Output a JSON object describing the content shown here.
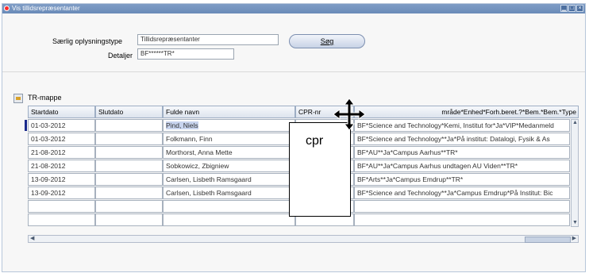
{
  "window": {
    "title": "Vis tillidsrepræsentanter"
  },
  "form": {
    "type_label": "Særlig oplysningstype",
    "type_value": "Tillidsrepræsentanter",
    "details_label": "Detaljer",
    "details_value": "BF******TR*",
    "search_button": "Søg"
  },
  "section": {
    "title": "TR-mappe"
  },
  "table": {
    "headers": [
      "Startdato",
      "Slutdato",
      "Fulde navn",
      "CPR-nr",
      "mråde*Enhed*Forh.beret.?*Bem.*Bem.*Type"
    ],
    "rows": [
      {
        "start": "01-03-2012",
        "end": "",
        "name": "Pind, Niels",
        "cpr": "",
        "desc": "BF*Science and Technology*Kemi, Institut for*Ja*VIP*Medanmeld"
      },
      {
        "start": "01-03-2012",
        "end": "",
        "name": "Folkmann, Finn",
        "cpr": "",
        "desc": "BF*Science and Technology**Ja*På institut: Datalogi, Fysik & As"
      },
      {
        "start": "21-08-2012",
        "end": "",
        "name": "Morthorst, Anna Mette",
        "cpr": "",
        "desc": "BF*AU**Ja*Campus Aarhus**TR*"
      },
      {
        "start": "21-08-2012",
        "end": "",
        "name": "Sobkowicz, Zbigniew",
        "cpr": "",
        "desc": "BF*AU**Ja*Campus Aarhus undtagen AU Viden**TR*"
      },
      {
        "start": "13-09-2012",
        "end": "",
        "name": "Carlsen, Lisbeth Ramsgaard",
        "cpr": "",
        "desc": "BF*Arts**Ja*Campus Emdrup**TR*"
      },
      {
        "start": "13-09-2012",
        "end": "",
        "name": "Carlsen, Lisbeth Ramsgaard",
        "cpr": "",
        "desc": "BF*Science and Technology**Ja*Campus Emdrup*På Institut: Bic"
      },
      {
        "start": "",
        "end": "",
        "name": "",
        "cpr": "",
        "desc": ""
      },
      {
        "start": "",
        "end": "",
        "name": "",
        "cpr": "",
        "desc": ""
      }
    ]
  },
  "overlay": {
    "label": "cpr"
  },
  "colors": {
    "titlebar": "#7f9dc6",
    "selection": "#c8d4ee",
    "row_marker": "#1a2a8c"
  },
  "icons": [
    "app-icon",
    "minimize-icon",
    "maximize-icon",
    "close-icon",
    "folder-icon",
    "move-cursor-icon"
  ]
}
